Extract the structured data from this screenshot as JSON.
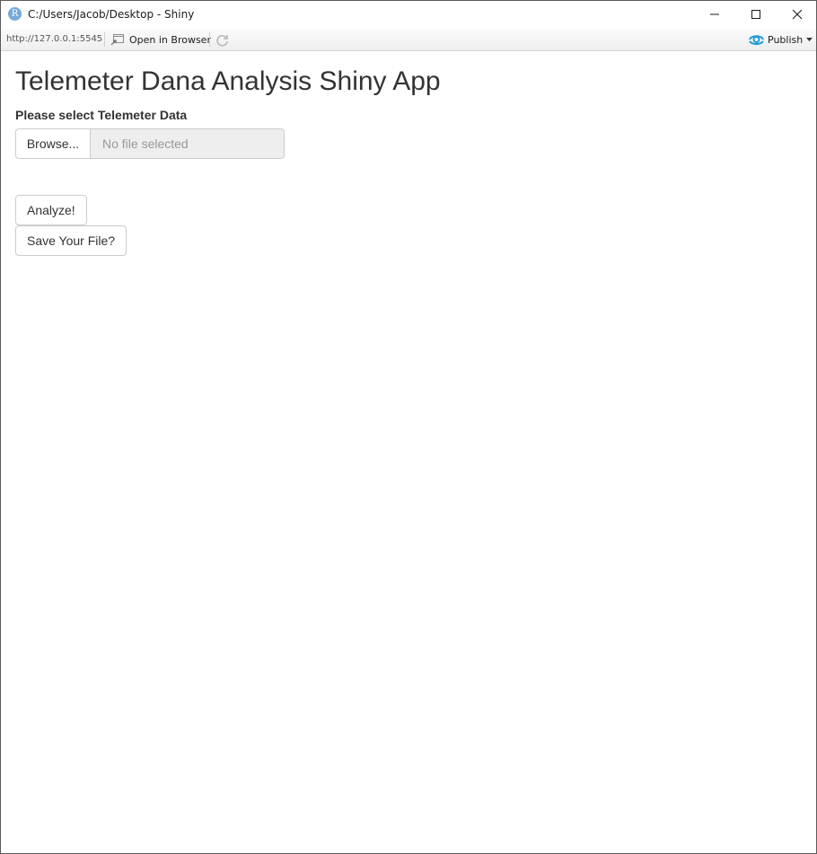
{
  "window": {
    "title": "C:/Users/Jacob/Desktop - Shiny",
    "app_icon_letter": "R"
  },
  "toolbar": {
    "url": "http://127.0.0.1:5545",
    "open_in_browser_label": "Open in Browser",
    "publish_label": "Publish",
    "accent_color": "#1e9ad6"
  },
  "app": {
    "title": "Telemeter Dana Analysis Shiny App",
    "file_input": {
      "label": "Please select Telemeter Data",
      "browse_label": "Browse...",
      "placeholder": "No file selected"
    },
    "analyze_label": "Analyze!",
    "save_label": "Save Your File?"
  }
}
